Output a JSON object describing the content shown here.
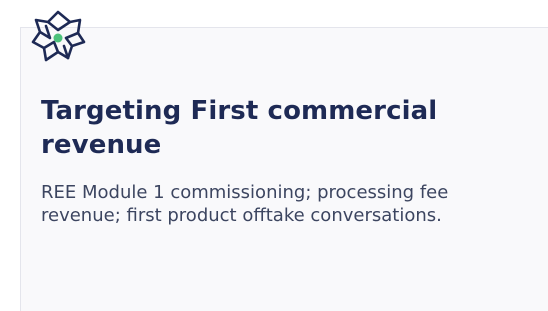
{
  "card": {
    "icon": "interlocked-ring-emblem-icon",
    "title": "Targeting First commercial revenue",
    "description": "REE Module 1 commissioning; processing fee revenue; first product offtake conversations."
  },
  "colors": {
    "title": "#1e2a55",
    "description": "#3c4560",
    "icon_stroke": "#1e2a55",
    "icon_dot": "#4cc27b",
    "card_background": "#f9f9fb",
    "card_border": "#e4e5ec"
  }
}
